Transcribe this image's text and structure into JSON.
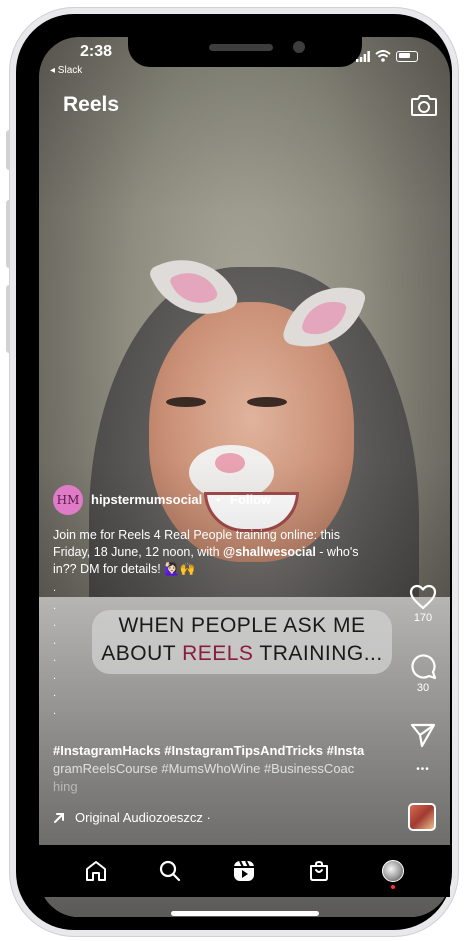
{
  "status_bar": {
    "time": "2:38",
    "back_app": "◂ Slack"
  },
  "header": {
    "title": "Reels",
    "camera_icon": "camera-icon"
  },
  "post": {
    "avatar_initials": "HM",
    "username": "hipstermumsocial",
    "separator": "•",
    "follow_label": "Follow",
    "caption_part1": "Join me for Reels 4 Real People training online: this Friday, 18 June, 12 noon, with ",
    "caption_mention": "@shallwesocial",
    "caption_part2": " - who's in?? DM for details! 🙋🏻‍♀️🙌",
    "dots": ".\n.\n.\n.\n.\n.\n.\n.",
    "overlay_line1": "WHEN PEOPLE ASK ME",
    "overlay_line2_pre": "ABOUT ",
    "overlay_line2_accent": "REELS",
    "overlay_line2_post": " TRAINING...",
    "hashtags_line1": "#InstagramHacks #InstagramTipsAndTricks #Insta",
    "hashtags_line2": "gramReelsCourse #MumsWhoWine #BusinessCoac",
    "hashtags_line3": "hing",
    "audio_label": "Original Audiozoeszcz ·"
  },
  "actions": {
    "likes": "170",
    "comments": "30",
    "more": "•••"
  },
  "colors": {
    "avatar_bg": "#e07bc8",
    "accent": "#8a1c3e",
    "badge": "#ff3040"
  },
  "nav": [
    "home-icon",
    "search-icon",
    "reels-icon",
    "shop-icon",
    "profile-avatar"
  ]
}
